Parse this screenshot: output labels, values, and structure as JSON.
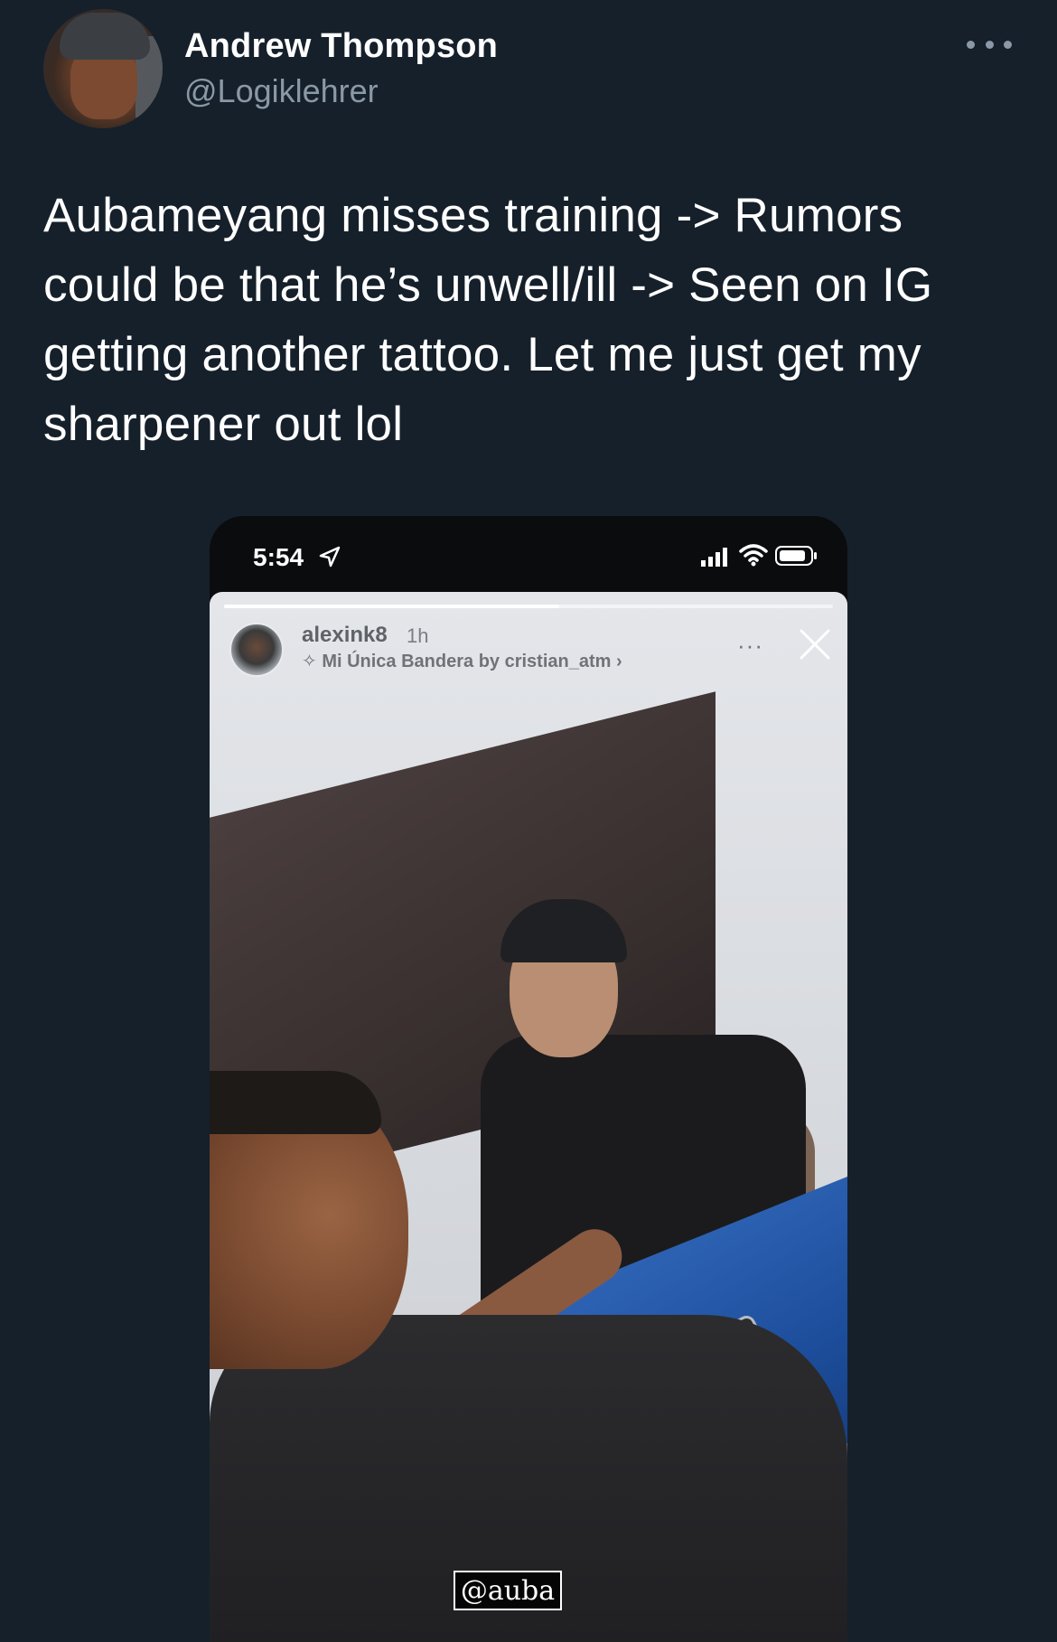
{
  "tweet": {
    "author_name": "Andrew Thompson",
    "author_handle": "@Logiklehrer",
    "text": "Aubameyang misses training -> Rumors could be that he’s unwell/ill -> Seen on IG getting another tattoo. Let me just get my sharpener out lol",
    "more_icon": "more-horizontal-icon"
  },
  "media": {
    "status_bar": {
      "time": "5:54",
      "icons": [
        "location-arrow-icon",
        "signal-icon",
        "wifi-icon",
        "battery-icon"
      ]
    },
    "story": {
      "progress": 0.55,
      "username": "alexink8",
      "time_ago": "1h",
      "music": "✧ Mi Única Bandera by cristian_atm ›",
      "more_label": "···",
      "mention": "@auba"
    }
  },
  "colors": {
    "background": "#15202b",
    "text_primary": "#ffffff",
    "text_secondary": "#8b98a5"
  }
}
